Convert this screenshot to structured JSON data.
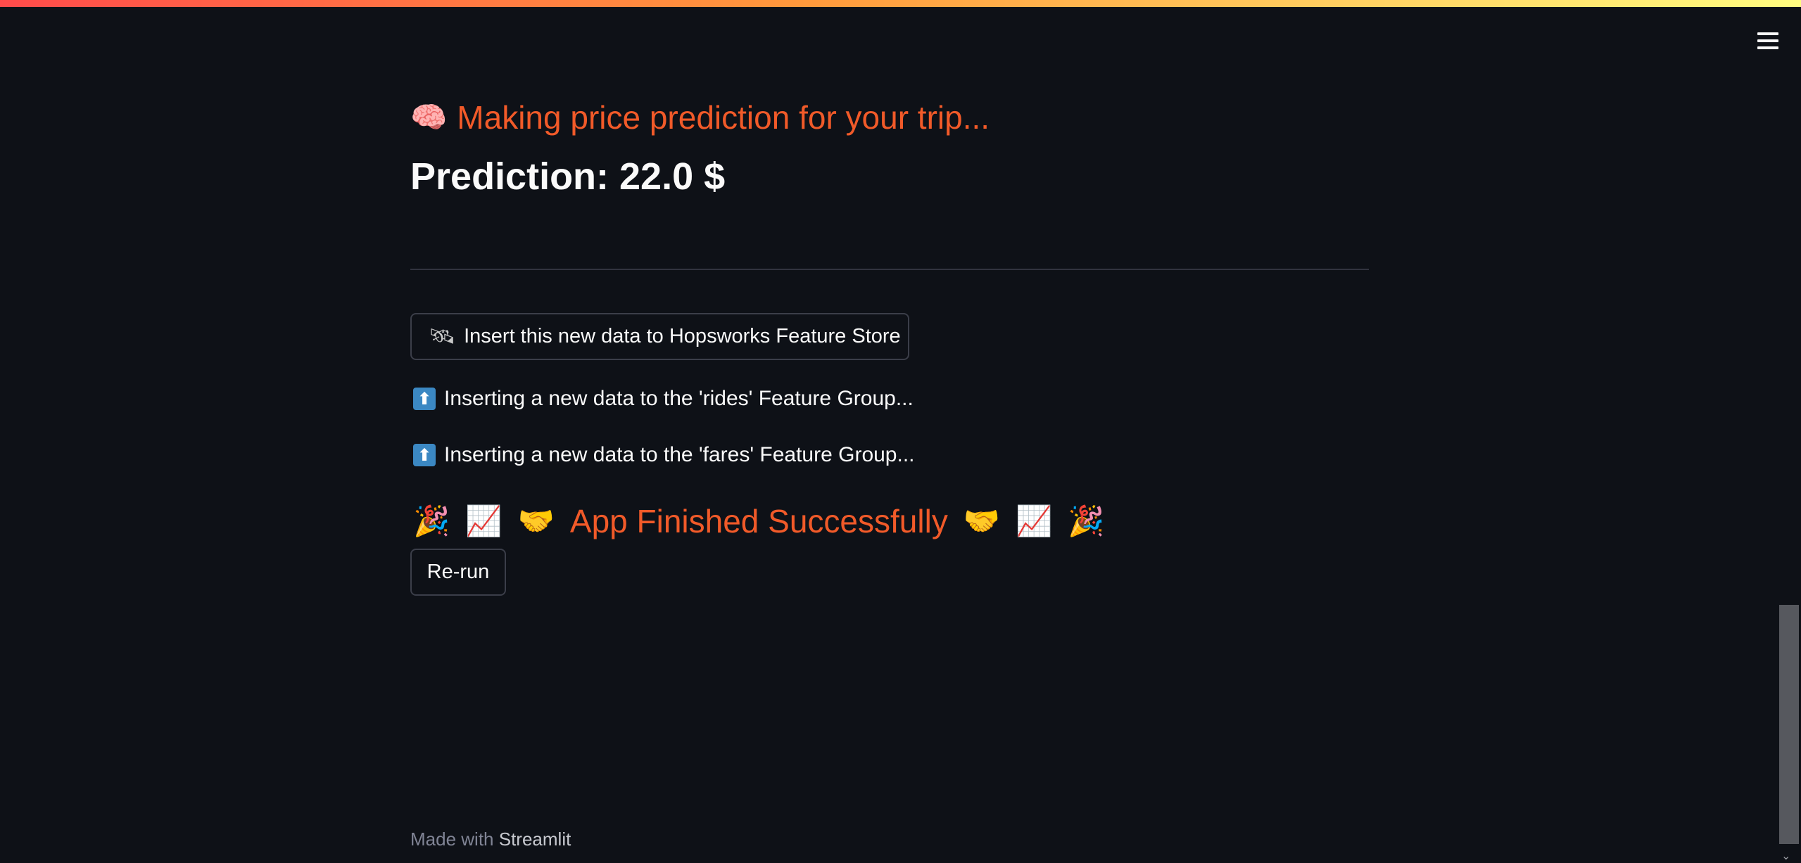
{
  "header": {
    "menu_icon": "hamburger-icon"
  },
  "main": {
    "subheader_emoji": "🧠",
    "subheader_text": "Making price prediction for your trip...",
    "prediction_text": "Prediction: 22.0 $",
    "insert_button": {
      "icon": "🛰",
      "label": "Insert this new data to Hopsworks Feature Store"
    },
    "status_messages": [
      {
        "icon": "⬆",
        "text": "Inserting a new data to the 'rides' Feature Group..."
      },
      {
        "icon": "⬆",
        "text": "Inserting a new data to the 'fares' Feature Group..."
      }
    ],
    "finished": {
      "emojis_left": [
        "🎉",
        "📈",
        "🤝"
      ],
      "text": "App Finished Successfully",
      "emojis_right": [
        "🤝",
        "📈",
        "🎉"
      ]
    },
    "rerun_label": "Re-run"
  },
  "footer": {
    "prefix": "Made with",
    "brand": "Streamlit"
  },
  "colors": {
    "background": "#0e1117",
    "accent": "#f15a29",
    "text": "#fafafa"
  }
}
